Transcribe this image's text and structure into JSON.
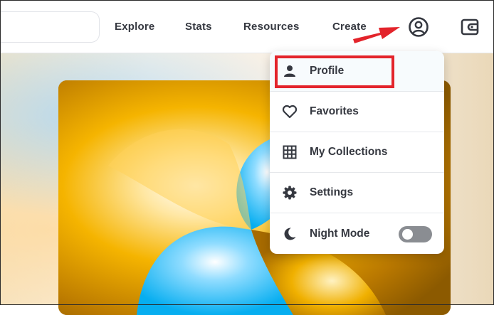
{
  "header": {
    "search": {
      "placeholder": ""
    },
    "nav": [
      "Explore",
      "Stats",
      "Resources",
      "Create"
    ],
    "account_icon": "account-circle-icon",
    "wallet_icon": "wallet-icon"
  },
  "dropdown": {
    "items": [
      {
        "label": "Profile",
        "icon": "person-icon"
      },
      {
        "label": "Favorites",
        "icon": "heart-icon"
      },
      {
        "label": "My Collections",
        "icon": "grid-icon"
      },
      {
        "label": "Settings",
        "icon": "gear-icon"
      },
      {
        "label": "Night Mode",
        "icon": "moon-icon",
        "toggle": false
      }
    ]
  },
  "colors": {
    "text": "#353840",
    "annotation_red": "#e3242b",
    "toggle_off": "#8a8d92",
    "art_gold": "#f2b000",
    "art_blue": "#1bb8f3"
  }
}
